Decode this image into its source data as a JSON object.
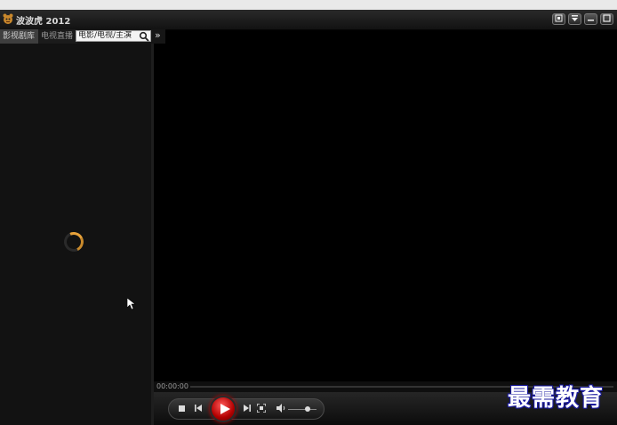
{
  "window": {
    "title": "波波虎 2012",
    "buttons": [
      "pin-icon",
      "menu-icon",
      "minimize-icon",
      "maximize-icon"
    ]
  },
  "tabs": [
    {
      "label": "影视剧库",
      "active": true
    },
    {
      "label": "电视直播",
      "active": false
    }
  ],
  "search": {
    "value": "电影/电视/主演",
    "icon": "search-icon"
  },
  "expand": {
    "label": "»"
  },
  "player": {
    "timecode": "00:00:00",
    "progress": 0.0,
    "volume": 0.7,
    "accent_color": "#c40000"
  },
  "watermark": {
    "text": "最需教育"
  }
}
